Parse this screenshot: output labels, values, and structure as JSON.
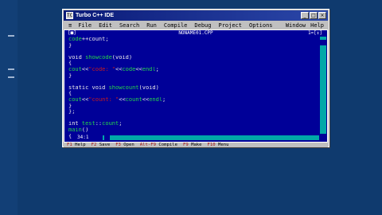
{
  "window": {
    "title": "Turbo C++ IDE",
    "icon_label": "TC",
    "minimize_glyph": "_",
    "maximize_glyph": "□",
    "close_glyph": "×"
  },
  "menubar": {
    "system": "≡",
    "items": [
      "File",
      "Edit",
      "Search",
      "Run",
      "Compile",
      "Debug",
      "Project",
      "Options",
      "Window",
      "Help"
    ]
  },
  "editor": {
    "close_box": "[■]",
    "filename": "NONAME01.CPP",
    "window_number": "1=[↕]",
    "position": "34:1",
    "lines": [
      [
        {
          "t": "code",
          "c": "g"
        },
        {
          "t": "++count;",
          "c": "w"
        }
      ],
      [
        {
          "t": "}",
          "c": "w"
        }
      ],
      [
        {
          "t": "",
          "c": "w"
        }
      ],
      [
        {
          "t": "void ",
          "c": "w"
        },
        {
          "t": "showcode",
          "c": "g"
        },
        {
          "t": "(void)",
          "c": "w"
        }
      ],
      [
        {
          "t": "{",
          "c": "w"
        }
      ],
      [
        {
          "t": "cout",
          "c": "g"
        },
        {
          "t": "<<",
          "c": "w"
        },
        {
          "t": "\"code: \"",
          "c": "r"
        },
        {
          "t": "<<",
          "c": "w"
        },
        {
          "t": "code",
          "c": "g"
        },
        {
          "t": "<<",
          "c": "w"
        },
        {
          "t": "endl",
          "c": "g"
        },
        {
          "t": ";",
          "c": "w"
        }
      ],
      [
        {
          "t": "}",
          "c": "w"
        }
      ],
      [
        {
          "t": "",
          "c": "w"
        }
      ],
      [
        {
          "t": "static void ",
          "c": "w"
        },
        {
          "t": "showcount",
          "c": "g"
        },
        {
          "t": "(void)",
          "c": "w"
        }
      ],
      [
        {
          "t": "{",
          "c": "w"
        }
      ],
      [
        {
          "t": "cout",
          "c": "g"
        },
        {
          "t": "<<",
          "c": "w"
        },
        {
          "t": "\"count: \"",
          "c": "r"
        },
        {
          "t": "<<",
          "c": "w"
        },
        {
          "t": "count",
          "c": "g"
        },
        {
          "t": "<<",
          "c": "w"
        },
        {
          "t": "endl",
          "c": "g"
        },
        {
          "t": ";",
          "c": "w"
        }
      ],
      [
        {
          "t": "}",
          "c": "w"
        }
      ],
      [
        {
          "t": "};",
          "c": "w"
        }
      ],
      [
        {
          "t": "",
          "c": "w"
        }
      ],
      [
        {
          "t": "int ",
          "c": "w"
        },
        {
          "t": "test",
          "c": "g"
        },
        {
          "t": "::",
          "c": "w"
        },
        {
          "t": "count",
          "c": "g"
        },
        {
          "t": ";",
          "c": "w"
        }
      ],
      [
        {
          "t": "main",
          "c": "g"
        },
        {
          "t": "()",
          "c": "w"
        }
      ],
      [
        {
          "t": "{",
          "c": "w"
        }
      ],
      [
        {
          "t": "",
          "c": "w"
        }
      ],
      [
        {
          "t": "}",
          "c": "w"
        }
      ]
    ]
  },
  "statusbar": {
    "items": [
      {
        "key": "F1",
        "label": " Help"
      },
      {
        "key": "F2",
        "label": " Save"
      },
      {
        "key": "F3",
        "label": " Open"
      },
      {
        "key": "Alt-F9",
        "label": " Compile"
      },
      {
        "key": "F9",
        "label": " Make"
      },
      {
        "key": "F10",
        "label": " Menu"
      }
    ]
  },
  "colors": {
    "desktop": "#0f3a6e",
    "editor_bg": "#000098",
    "keyword": "#e8e8e8",
    "identifier": "#24d24a",
    "string": "#c81b1b",
    "scrollbar": "#00a8a8"
  }
}
